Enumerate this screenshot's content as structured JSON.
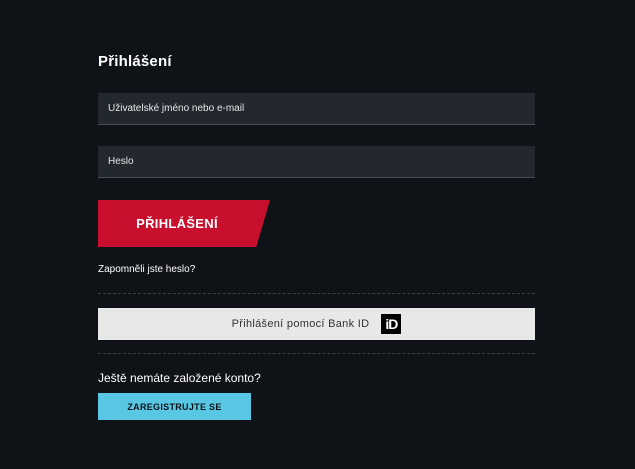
{
  "login": {
    "title": "Přihlášení",
    "username_placeholder": "Uživatelské jméno nebo e-mail",
    "password_placeholder": "Heslo",
    "login_button_label": "PŘIHLÁŠENÍ",
    "forgot_password_link": "Zapomněli jste heslo?"
  },
  "bankid": {
    "button_label": "Přihlášení pomocí Bank ID",
    "logo_text": "iD",
    "logo_icon": "bankid-logo-icon"
  },
  "register": {
    "prompt": "Ještě nemáte založené konto?",
    "button_label": "ZAREGISTRUJTE SE"
  },
  "colors": {
    "background": "#0f1318",
    "field_background": "#23272e",
    "login_button": "#c8102e",
    "bankid_button": "#e8e8e8",
    "register_button": "#57c7e3",
    "text": "#ffffff"
  }
}
